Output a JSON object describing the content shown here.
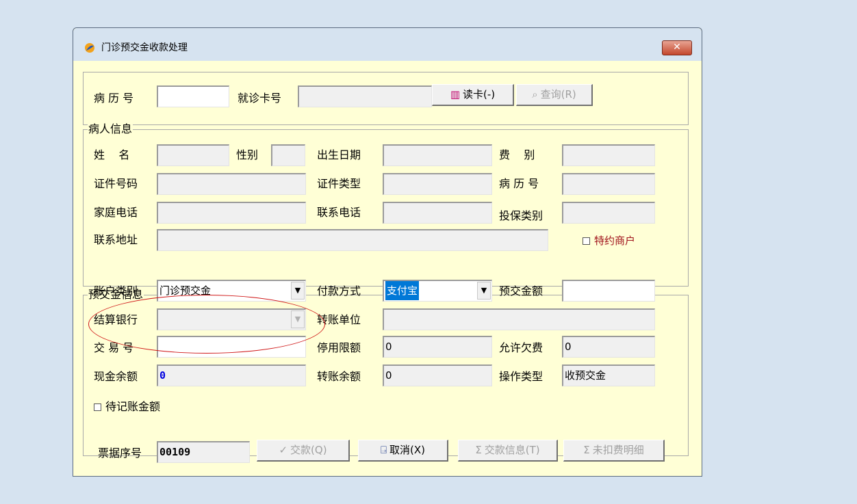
{
  "window": {
    "title": "门诊预交金收款处理",
    "close_label": "✕"
  },
  "top": {
    "record_no_label": "病 历 号",
    "record_no_value": "",
    "card_no_label": "就诊卡号",
    "card_no_value": "",
    "read_card_btn": "读卡(-)",
    "query_btn": "查询(R)"
  },
  "patient": {
    "group_title": "病人信息",
    "name_label": "姓    名",
    "name_value": "",
    "gender_label": "性别",
    "gender_value": "",
    "birth_label": "出生日期",
    "birth_value": "",
    "fee_type_label": "费    别",
    "fee_type_value": "",
    "id_no_label": "证件号码",
    "id_no_value": "",
    "id_type_label": "证件类型",
    "id_type_value": "",
    "record_no_label": "病 历 号",
    "record_no_value": "",
    "home_phone_label": "家庭电话",
    "home_phone_value": "",
    "contact_phone_label": "联系电话",
    "contact_phone_value": "",
    "insurance_type_label": "投保类别",
    "insurance_type_value": "",
    "address_label": "联系地址",
    "address_value": "",
    "special_merchant_label": "特约商户"
  },
  "deposit": {
    "group_title": "预交金信息",
    "account_type_label": "账户类别",
    "account_type_value": "门诊预交金",
    "payment_method_label": "付款方式",
    "payment_method_value": "支付宝",
    "deposit_amount_label": "预交金额",
    "deposit_amount_value": "",
    "settle_bank_label": "结算银行",
    "settle_bank_value": "",
    "transfer_unit_label": "转账单位",
    "transfer_unit_value": "",
    "trade_no_label": "交 易 号",
    "trade_no_value": "",
    "stop_limit_label": "停用限额",
    "stop_limit_value": "0",
    "allow_arrears_label": "允许欠费",
    "allow_arrears_value": "0",
    "cash_balance_label": "现金余额",
    "cash_balance_value": "0",
    "transfer_balance_label": "转账余额",
    "transfer_balance_value": "0",
    "operation_type_label": "操作类型",
    "operation_type_value": "收预交金",
    "pending_amount_label": "待记账金额"
  },
  "footer": {
    "receipt_no_label": "票据序号",
    "receipt_no_value": "00109",
    "pay_btn": "交款(Q)",
    "cancel_btn": "取消(X)",
    "pay_info_btn": "交款信息(T)",
    "unpaid_detail_btn": "未扣费明细"
  }
}
